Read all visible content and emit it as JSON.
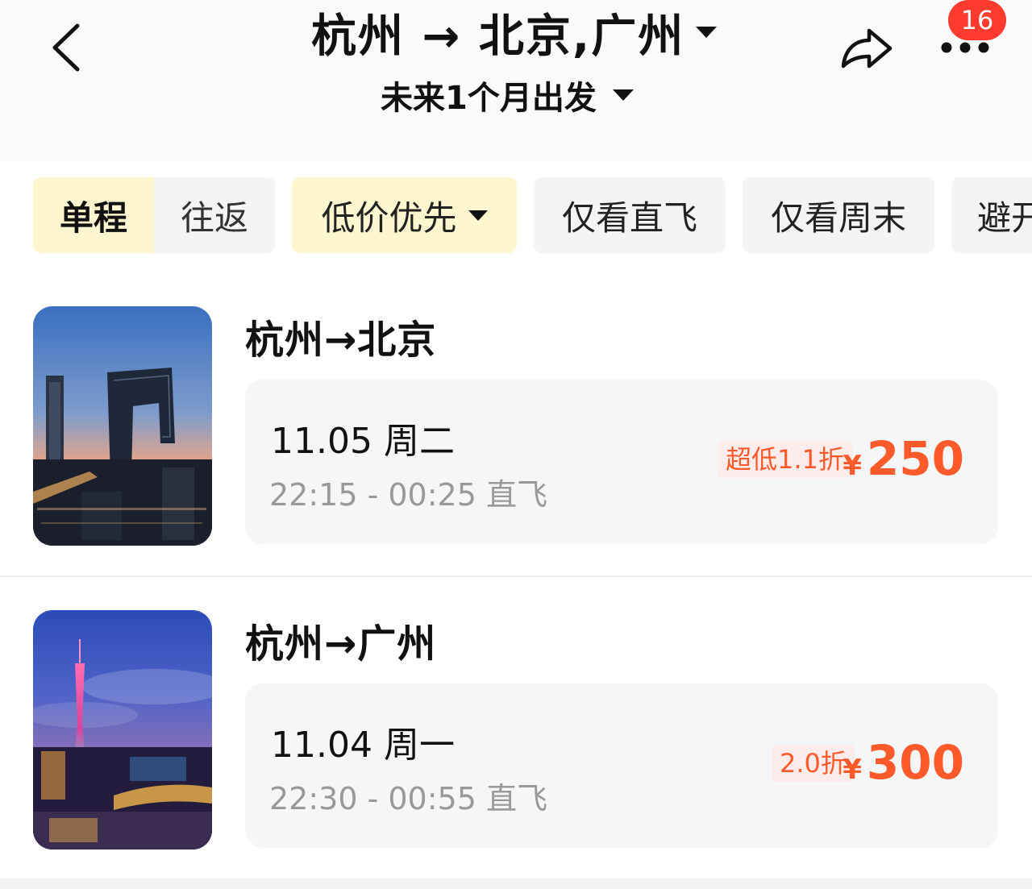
{
  "header": {
    "title": "杭州 → 北京,广州",
    "subtitle": "未来1个月出发",
    "badge_count": "16",
    "icons": [
      "back-arrow-icon",
      "share-icon",
      "more-icon"
    ]
  },
  "filters": {
    "trip_type": {
      "selected": "单程",
      "other": "往返"
    },
    "sort": "低价优先",
    "chips": [
      "仅看直飞",
      "仅看周末",
      "避开"
    ]
  },
  "routes": [
    {
      "title": "杭州→北京",
      "date": "11.05 周二",
      "time": "22:15 - 00:25  直飞",
      "discount": "超低1.1折",
      "currency": "¥",
      "price": "250"
    },
    {
      "title": "杭州→广州",
      "date": "11.04 周一",
      "time": "22:30 - 00:55  直飞",
      "discount": "2.0折",
      "currency": "¥",
      "price": "300"
    }
  ],
  "colors": {
    "accent_red": "#ff5a2a",
    "badge_red": "#ff3b30",
    "highlight_yellow": "#fdf6cf"
  }
}
